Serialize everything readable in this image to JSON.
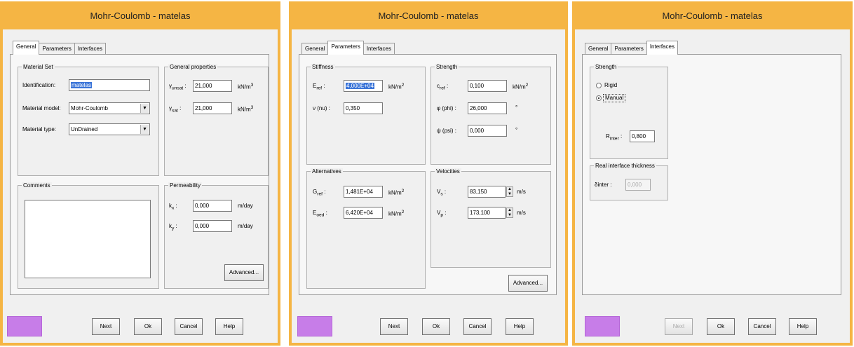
{
  "title": "Mohr-Coulomb - matelas",
  "tabs": {
    "general": "General",
    "parameters": "Parameters",
    "interfaces": "Interfaces"
  },
  "buttons": {
    "next": "Next",
    "ok": "Ok",
    "cancel": "Cancel",
    "help": "Help",
    "advanced": "Advanced..."
  },
  "colors": {
    "window_frame": "#f5b544",
    "material_swatch": "#c77de8"
  },
  "general": {
    "material_set_title": "Material Set",
    "identification_label": "Identification:",
    "identification_value": "matelas",
    "material_model_label": "Material model:",
    "material_model_value": "Mohr-Coulomb",
    "material_type_label": "Material type:",
    "material_type_value": "UnDrained",
    "general_properties_title": "General properties",
    "gamma_unsat_symbol": "γ",
    "gamma_unsat_sub": "unsat",
    "gamma_unsat_value": "21,000",
    "gamma_sat_symbol": "γ",
    "gamma_sat_sub": "sat",
    "gamma_sat_value": "21,000",
    "unit_weight": "kN/m",
    "unit_power": "3",
    "comments_title": "Comments",
    "permeability_title": "Permeability",
    "kx_label": "k",
    "kx_sub": "x",
    "kx_value": "0,000",
    "ky_label": "k",
    "ky_sub": "y",
    "ky_value": "0,000",
    "unit_perm": "m/day"
  },
  "parameters": {
    "stiffness_title": "Stiffness",
    "eref_label": "E",
    "eref_sub": "ref",
    "eref_value": "4,000E+04",
    "nu_label": "ν (nu) :",
    "nu_value": "0,350",
    "unit_modulus": "kN/m",
    "unit_power": "2",
    "strength_title": "Strength",
    "cref_label": "c",
    "cref_sub": "ref",
    "cref_value": "0,100",
    "phi_label": "φ (phi) :",
    "phi_value": "26,000",
    "psi_label": "ψ (psi) :",
    "psi_value": "0,000",
    "unit_deg": "°",
    "alternatives_title": "Alternatives",
    "gref_label": "G",
    "gref_sub": "ref",
    "gref_value": "1,481E+04",
    "eoed_label": "E",
    "eoed_sub": "oed",
    "eoed_value": "6,420E+04",
    "velocities_title": "Velocities",
    "vs_label": "V",
    "vs_sub": "s",
    "vs_value": "83,150",
    "vp_label": "V",
    "vp_sub": "p",
    "vp_value": "173,100",
    "unit_velocity": "m/s"
  },
  "interfaces": {
    "strength_title": "Strength",
    "rigid_label": "Rigid",
    "manual_label": "Manual",
    "rinter_label": "R",
    "rinter_sub": "inter",
    "rinter_value": "0,800",
    "thickness_title": "Real interface thickness",
    "delta_label": "δinter :",
    "delta_value": "0,000"
  }
}
